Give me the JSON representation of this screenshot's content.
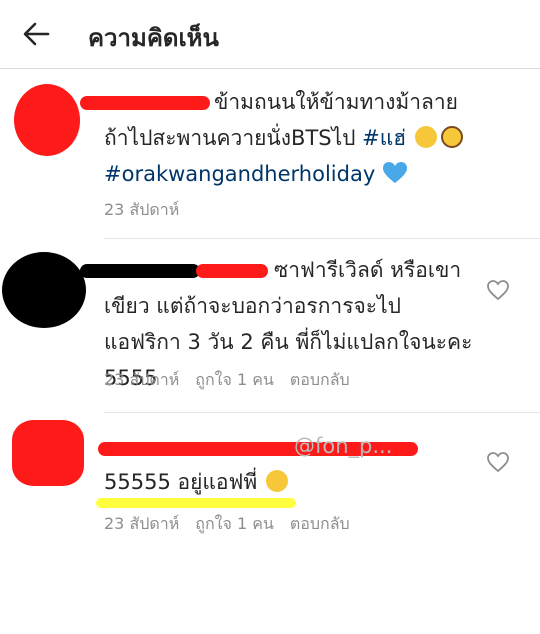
{
  "header": {
    "title": "ความคิดเห็น",
    "back_icon": "arrow-left-icon"
  },
  "comments": [
    {
      "text_before": "ข้ามถนนให้ข้ามทางม้าลาย ถ้าไปสะพานควายนั่งBTSไป ",
      "hashtag1": "#แฮ่",
      "hashtag2": "#orakwangandherholiday",
      "time": "23 สัปดาห์",
      "emojis": [
        "winking-face-tongue-emoji",
        "nerd-face-emoji",
        "blue-heart-emoji"
      ]
    },
    {
      "text": "ซาฟารีเวิลด์ หรือเขาเขียว แต่ถ้าจะบอกว่าอรการจะไปแอฟริกา 3 วัน 2 คืน พี่ก็ไม่แปลกใจนะคะ 5555",
      "time": "23 สัปดาห์",
      "likes": "ถูกใจ 1 คน",
      "reply": "ตอบกลับ",
      "like_icon": "heart-icon"
    },
    {
      "mention": "@fon_p...",
      "text": "55555 อยู่แอฟพี่",
      "time": "23 สัปดาห์",
      "likes": "ถูกใจ 1 คน",
      "reply": "ตอบกลับ",
      "like_icon": "heart-icon",
      "emoji": "winking-face-tongue-emoji"
    }
  ],
  "colors": {
    "hashtag": "#003569",
    "meta": "#8e8e8e",
    "redact_red": "#ff0000",
    "redact_black": "#000000",
    "highlight_yellow": "#ffff2a"
  }
}
